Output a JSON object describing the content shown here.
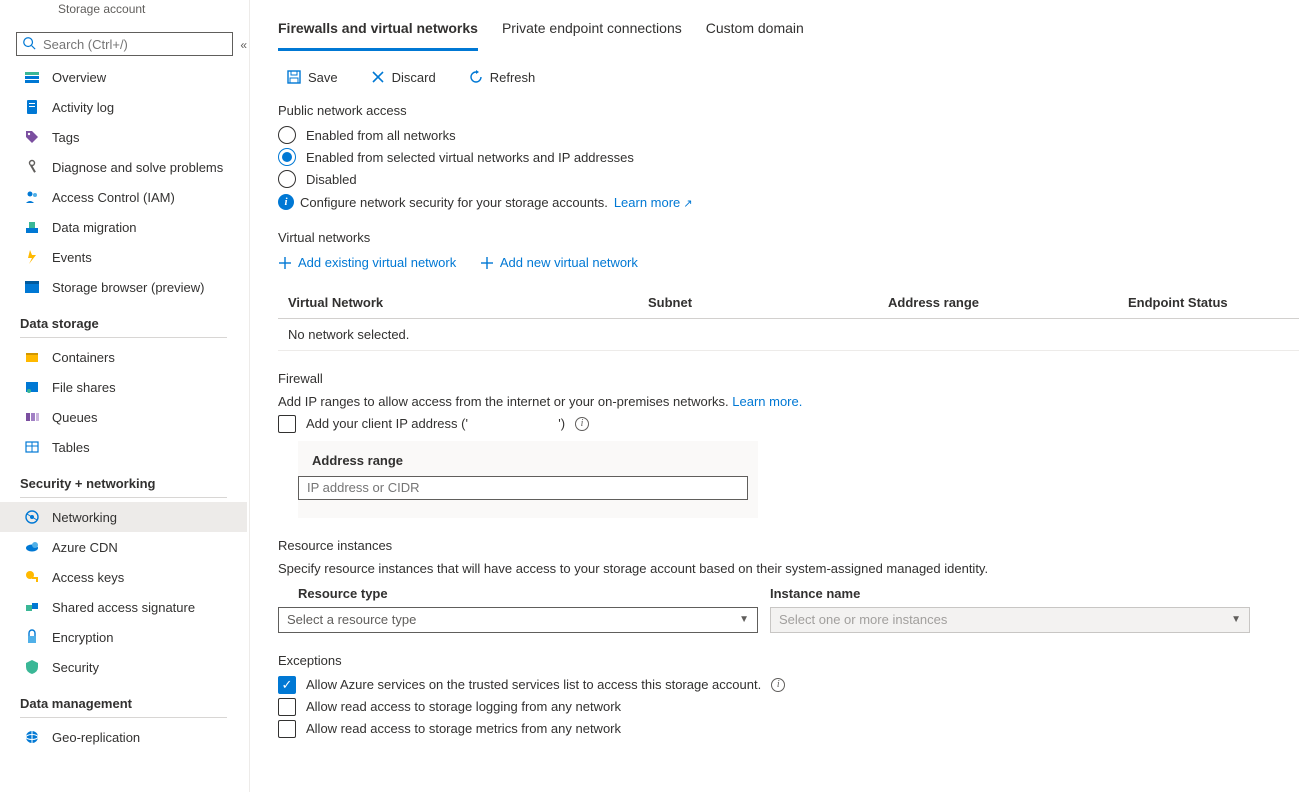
{
  "breadcrumb_sub": "Storage account",
  "search": {
    "placeholder": "Search (Ctrl+/)"
  },
  "nav": {
    "items_top": [
      {
        "icon": "overview",
        "label": "Overview"
      },
      {
        "icon": "activity",
        "label": "Activity log"
      },
      {
        "icon": "tags",
        "label": "Tags"
      },
      {
        "icon": "diagnose",
        "label": "Diagnose and solve problems"
      },
      {
        "icon": "iam",
        "label": "Access Control (IAM)"
      },
      {
        "icon": "migration",
        "label": "Data migration"
      },
      {
        "icon": "events",
        "label": "Events"
      },
      {
        "icon": "browser",
        "label": "Storage browser (preview)"
      }
    ],
    "group_storage": "Data storage",
    "items_storage": [
      {
        "icon": "containers",
        "label": "Containers"
      },
      {
        "icon": "fileshares",
        "label": "File shares"
      },
      {
        "icon": "queues",
        "label": "Queues"
      },
      {
        "icon": "tables",
        "label": "Tables"
      }
    ],
    "group_security": "Security + networking",
    "items_security": [
      {
        "icon": "networking",
        "label": "Networking",
        "selected": true
      },
      {
        "icon": "cdn",
        "label": "Azure CDN"
      },
      {
        "icon": "keys",
        "label": "Access keys"
      },
      {
        "icon": "sas",
        "label": "Shared access signature"
      },
      {
        "icon": "encryption",
        "label": "Encryption"
      },
      {
        "icon": "security",
        "label": "Security"
      }
    ],
    "group_mgmt": "Data management",
    "items_mgmt": [
      {
        "icon": "geo",
        "label": "Geo-replication"
      }
    ]
  },
  "tabs": [
    {
      "label": "Firewalls and virtual networks",
      "active": true
    },
    {
      "label": "Private endpoint connections"
    },
    {
      "label": "Custom domain"
    }
  ],
  "toolbar": {
    "save": "Save",
    "discard": "Discard",
    "refresh": "Refresh"
  },
  "public_access": {
    "title": "Public network access",
    "opt1": "Enabled from all networks",
    "opt2": "Enabled from selected virtual networks and IP addresses",
    "opt3": "Disabled",
    "info": "Configure network security for your storage accounts.",
    "learn": "Learn more"
  },
  "vnets": {
    "title": "Virtual networks",
    "add_existing": "Add existing virtual network",
    "add_new": "Add new virtual network",
    "col_vn": "Virtual Network",
    "col_subnet": "Subnet",
    "col_range": "Address range",
    "col_status": "Endpoint Status",
    "empty": "No network selected."
  },
  "firewall": {
    "title": "Firewall",
    "desc": "Add IP ranges to allow access from the internet or your on-premises networks.",
    "learn": "Learn more.",
    "client_ip": "Add your client IP address ('",
    "client_ip2": "')",
    "addr_label": "Address range",
    "addr_placeholder": "IP address or CIDR"
  },
  "resource": {
    "title": "Resource instances",
    "desc": "Specify resource instances that will have access to your storage account based on their system-assigned managed identity.",
    "type_label": "Resource type",
    "instance_label": "Instance name",
    "type_placeholder": "Select a resource type",
    "instance_placeholder": "Select one or more instances"
  },
  "exceptions": {
    "title": "Exceptions",
    "c1": "Allow Azure services on the trusted services list to access this storage account.",
    "c2": "Allow read access to storage logging from any network",
    "c3": "Allow read access to storage metrics from any network"
  }
}
